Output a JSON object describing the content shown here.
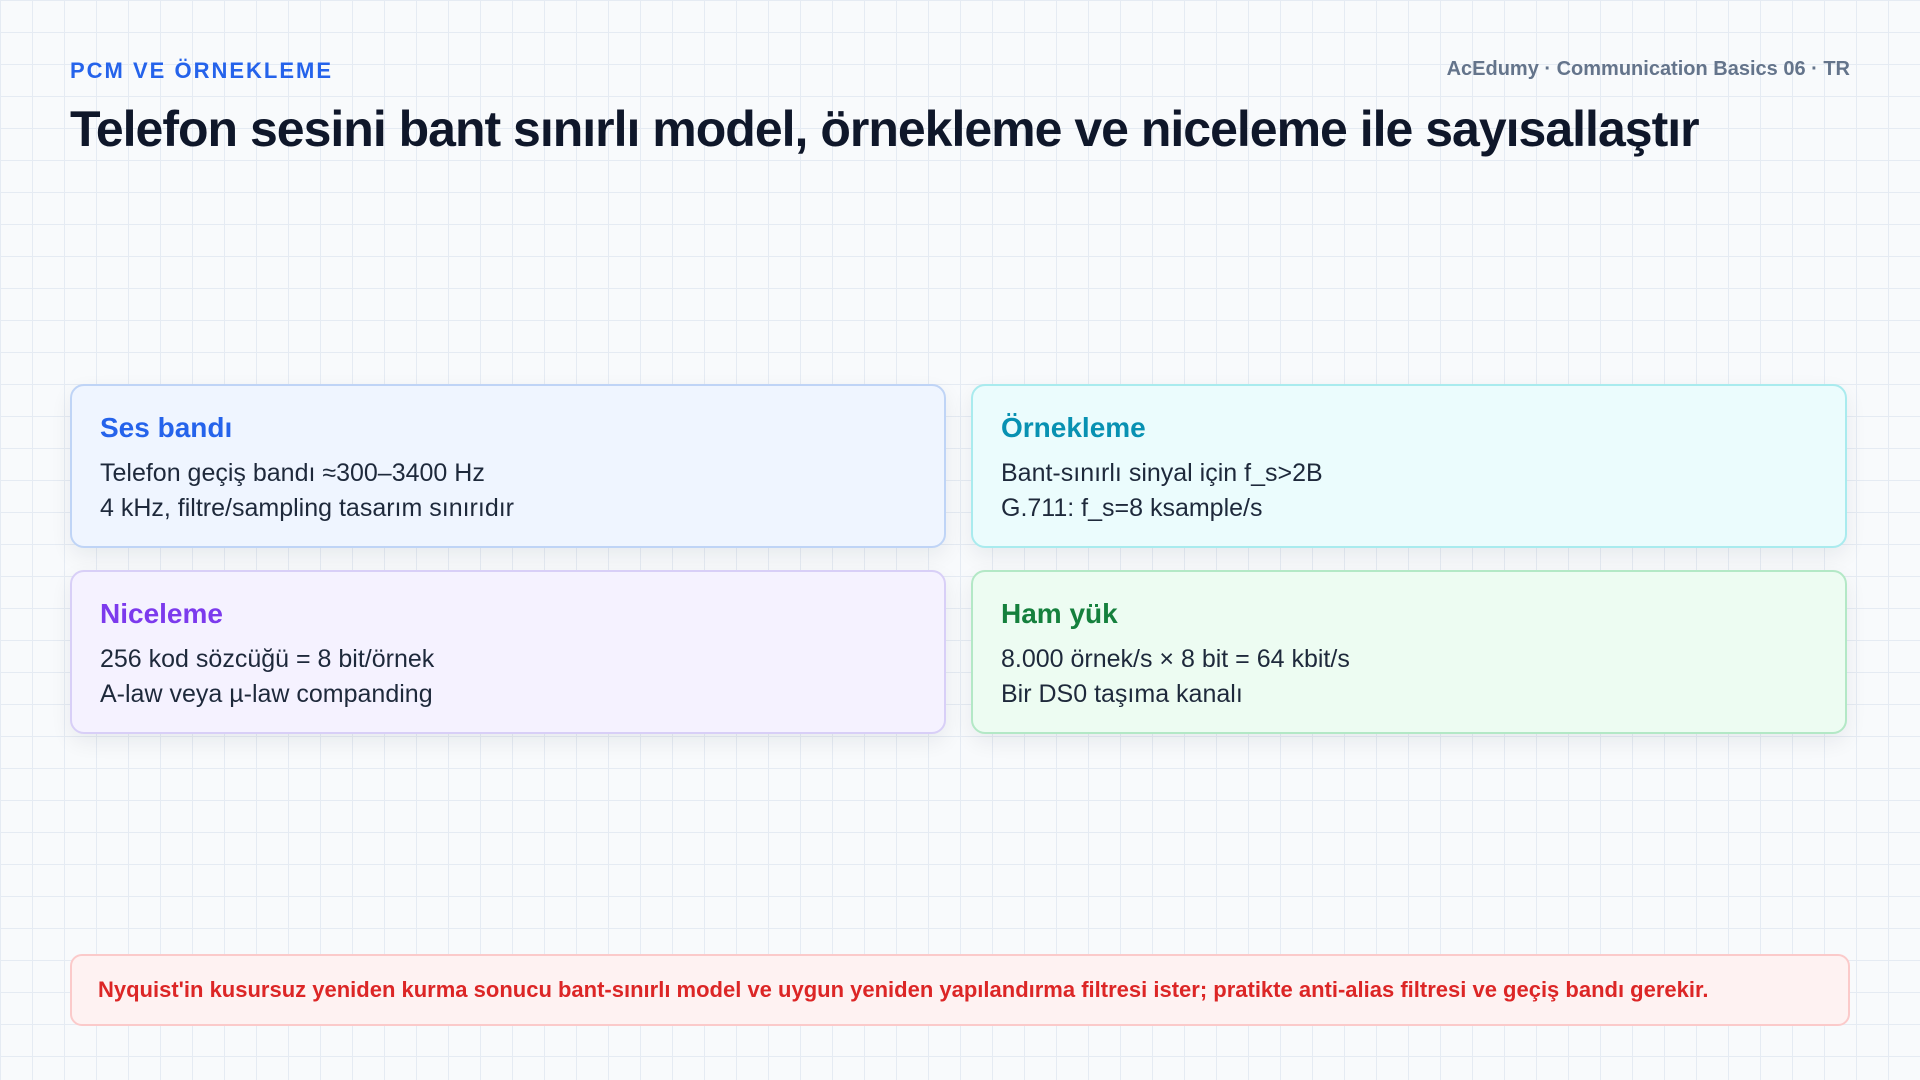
{
  "header": {
    "kicker": "PCM VE ÖRNEKLEME",
    "brand": "AcEdumy · Communication Basics 06 · TR",
    "title": "Telefon sesini bant sınırlı model, örnekleme ve niceleme ile sayısallaştır"
  },
  "cards": [
    {
      "heading": "Ses bandı",
      "lines": [
        "Telefon geçiş bandı ≈300–3400 Hz",
        "4 kHz, filtre/sampling tasarım sınırıdır"
      ],
      "accent": "#2563eb"
    },
    {
      "heading": "Örnekleme",
      "lines": [
        "Bant-sınırlı sinyal için f_s>2B",
        "G.711: f_s=8 ksample/s"
      ],
      "accent": "#0891b2"
    },
    {
      "heading": "Niceleme",
      "lines": [
        "256 kod sözcüğü = 8 bit/örnek",
        "A-law veya µ-law companding"
      ],
      "accent": "#7c3aed"
    },
    {
      "heading": "Ham yük",
      "lines": [
        "8.000 örnek/s × 8 bit = 64 kbit/s",
        "Bir DS0 taşıma kanalı"
      ],
      "accent": "#15803d"
    }
  ],
  "note": {
    "text": "Nyquist'in kusursuz yeniden kurma sonucu bant-sınırlı model ve uygun yeniden yapılandırma filtresi ister; pratikte anti-alias filtresi ve geçiş bandı gerekir.",
    "accent": "#dc2626"
  }
}
